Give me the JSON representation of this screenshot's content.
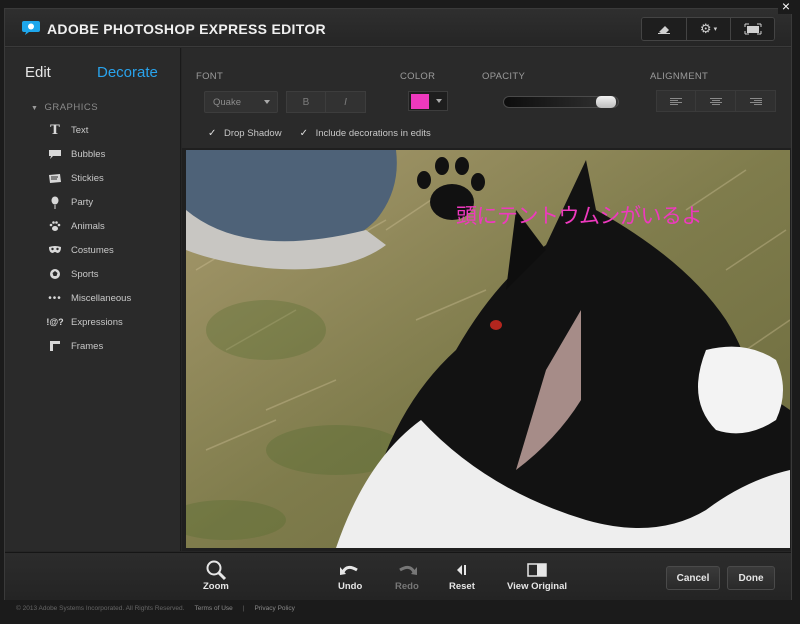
{
  "app": {
    "title": "ADOBE PHOTOSHOP EXPRESS EDITOR",
    "close": "×"
  },
  "modes": {
    "edit": "Edit",
    "decorate": "Decorate"
  },
  "sidebar": {
    "group": "GRAPHICS",
    "items": [
      {
        "label": "Text",
        "icon": "text-icon"
      },
      {
        "label": "Bubbles",
        "icon": "bubble-icon"
      },
      {
        "label": "Stickies",
        "icon": "sticky-icon"
      },
      {
        "label": "Party",
        "icon": "balloon-icon"
      },
      {
        "label": "Animals",
        "icon": "paw-icon"
      },
      {
        "label": "Costumes",
        "icon": "mask-icon"
      },
      {
        "label": "Sports",
        "icon": "ball-icon"
      },
      {
        "label": "Miscellaneous",
        "icon": "dots-icon"
      },
      {
        "label": "Expressions",
        "icon": "symbols-icon"
      },
      {
        "label": "Frames",
        "icon": "frame-icon"
      }
    ]
  },
  "options": {
    "font_label": "FONT",
    "font_value": "Quake",
    "bold_label": "B",
    "italic_label": "I",
    "color_label": "COLOR",
    "color_value": "#ee39be",
    "opacity_label": "OPACITY",
    "opacity_value": 1.0,
    "alignment_label": "ALIGNMENT",
    "drop_shadow": "Drop Shadow",
    "include_decorations": "Include decorations in edits"
  },
  "canvas": {
    "overlay_text": "頭にテントウムシがいるよ"
  },
  "toolbar": {
    "zoom": "Zoom",
    "undo": "Undo",
    "redo": "Redo",
    "reset": "Reset",
    "view_original": "View Original",
    "cancel": "Cancel",
    "done": "Done"
  },
  "footer": {
    "copyright": "© 2013 Adobe Systems Incorporated. All Rights Reserved.",
    "terms": "Terms of Use",
    "privacy": "Privacy Policy"
  }
}
